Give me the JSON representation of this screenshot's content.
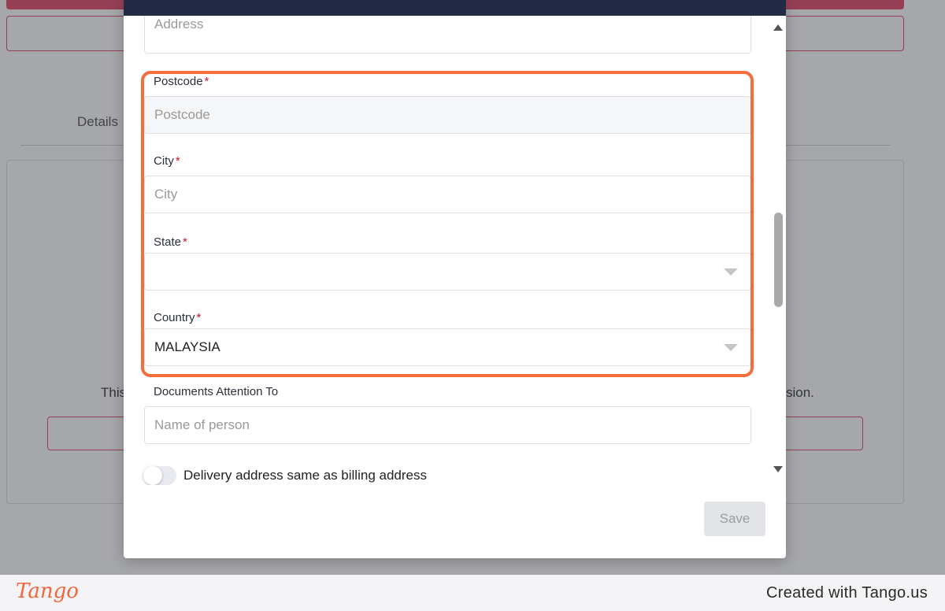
{
  "background": {
    "tab_label": "Details",
    "text_left_fragment": "This",
    "text_right_fragment": "sion."
  },
  "form": {
    "address": {
      "placeholder": "Address"
    },
    "postcode": {
      "label": "Postcode",
      "required": "*",
      "placeholder": "Postcode"
    },
    "city": {
      "label": "City",
      "required": "*",
      "placeholder": "City"
    },
    "state": {
      "label": "State",
      "required": "*",
      "value": ""
    },
    "country": {
      "label": "Country",
      "required": "*",
      "value": "MALAYSIA"
    },
    "documents_attention": {
      "label": "Documents Attention To",
      "placeholder": "Name of person"
    },
    "delivery_toggle": {
      "label": "Delivery address same as billing address",
      "checked": false
    }
  },
  "actions": {
    "save_label": "Save"
  },
  "footer": {
    "logo": "Tango",
    "credit": "Created with Tango.us"
  },
  "colors": {
    "highlight": "#f46d3a",
    "accent_red": "#e0395a",
    "header": "#232a45",
    "required": "#d0142c"
  }
}
